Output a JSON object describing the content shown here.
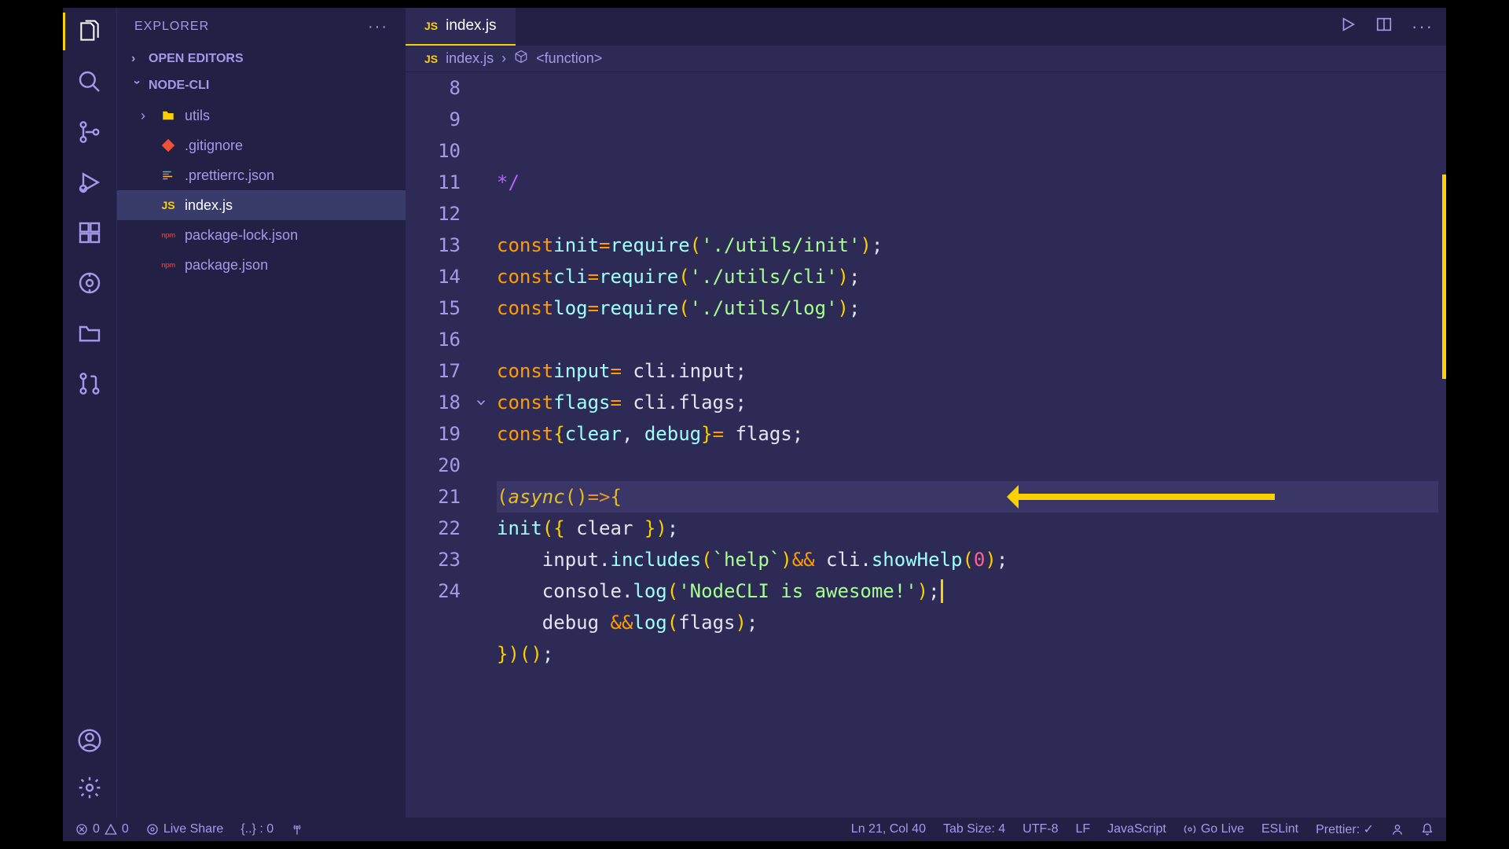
{
  "sidebar": {
    "title": "EXPLORER",
    "sections": {
      "openEditors": "OPEN EDITORS",
      "workspace": "NODE-CLI"
    },
    "tree": [
      {
        "type": "folder",
        "name": "utils",
        "iconClass": "icon-folder"
      },
      {
        "type": "file",
        "name": ".gitignore",
        "iconClass": "icon-git"
      },
      {
        "type": "file",
        "name": ".prettierrc.json",
        "iconClass": "icon-prettier"
      },
      {
        "type": "file",
        "name": "index.js",
        "iconClass": "icon-js",
        "selected": true
      },
      {
        "type": "file",
        "name": "package-lock.json",
        "iconClass": "icon-npm"
      },
      {
        "type": "file",
        "name": "package.json",
        "iconClass": "icon-npm"
      }
    ]
  },
  "tabs": {
    "active": "index.js"
  },
  "breadcrumb": {
    "file": "index.js",
    "symbol": "<function>"
  },
  "code": {
    "startLine": 8,
    "highlightLine": 21,
    "cursor": {
      "line": 21,
      "col": 40
    },
    "lines": [
      {
        "n": 8,
        "html": " <span class='comment'>*/</span>"
      },
      {
        "n": 9,
        "html": ""
      },
      {
        "n": 10,
        "html": "<span class='kw-const'>const</span> <span class='var'>init</span> <span class='op'>=</span> <span class='fn'>require</span><span class='paren'>(</span><span class='str'>'./utils/init'</span><span class='paren'>)</span>;"
      },
      {
        "n": 11,
        "html": "<span class='kw-const'>const</span> <span class='var'>cli</span> <span class='op'>=</span> <span class='fn'>require</span><span class='paren'>(</span><span class='str'>'./utils/cli'</span><span class='paren'>)</span>;"
      },
      {
        "n": 12,
        "html": "<span class='kw-const'>const</span> <span class='var'>log</span> <span class='op'>=</span> <span class='fn'>require</span><span class='paren'>(</span><span class='str'>'./utils/log'</span><span class='paren'>)</span>;"
      },
      {
        "n": 13,
        "html": ""
      },
      {
        "n": 14,
        "html": "<span class='kw-const'>const</span> <span class='var'>input</span> <span class='op'>=</span> cli.input;"
      },
      {
        "n": 15,
        "html": "<span class='kw-const'>const</span> <span class='var'>flags</span> <span class='op'>=</span> cli.flags;"
      },
      {
        "n": 16,
        "html": "<span class='kw-const'>const</span> <span class='paren'>{</span> <span class='var'>clear</span>, <span class='var'>debug</span> <span class='paren'>}</span> <span class='op'>=</span> flags;"
      },
      {
        "n": 17,
        "html": ""
      },
      {
        "n": 18,
        "html": "<span class='paren'>(</span><span class='async-kw'>async</span> <span class='paren'>()</span> <span class='op'>=&gt;</span> <span class='paren'>{</span>",
        "fold": true
      },
      {
        "n": 19,
        "html": "    <span class='fn'>init</span><span class='paren'>(</span><span class='paren2'>{</span> clear <span class='paren2'>}</span><span class='paren'>)</span>;"
      },
      {
        "n": 20,
        "html": "    input.<span class='fn'>includes</span><span class='paren'>(</span><span class='str'>`help`</span><span class='paren'>)</span> <span class='op'>&amp;&amp;</span> cli.<span class='fn'>showHelp</span><span class='paren'>(</span><span class='num'>0</span><span class='paren'>)</span>;"
      },
      {
        "n": 21,
        "html": "    console.<span class='fn'>log</span><span class='paren'>(</span><span class='str'>'NodeCLI is awesome!'</span><span class='paren'>)</span>;<span class='cursor'></span>"
      },
      {
        "n": 22,
        "html": "    debug <span class='op'>&amp;&amp;</span> <span class='fn'>log</span><span class='paren'>(</span>flags<span class='paren'>)</span>;"
      },
      {
        "n": 23,
        "html": "<span class='paren'>}</span><span class='paren'>)()</span>;"
      },
      {
        "n": 24,
        "html": ""
      }
    ]
  },
  "status": {
    "errors": "0",
    "warnings": "0",
    "liveShare": "Live Share",
    "bracket": "{..} : 0",
    "cursorPos": "Ln 21, Col 40",
    "tabSize": "Tab Size: 4",
    "encoding": "UTF-8",
    "eol": "LF",
    "language": "JavaScript",
    "goLive": "Go Live",
    "eslint": "ESLint",
    "prettier": "Prettier: ✓"
  }
}
